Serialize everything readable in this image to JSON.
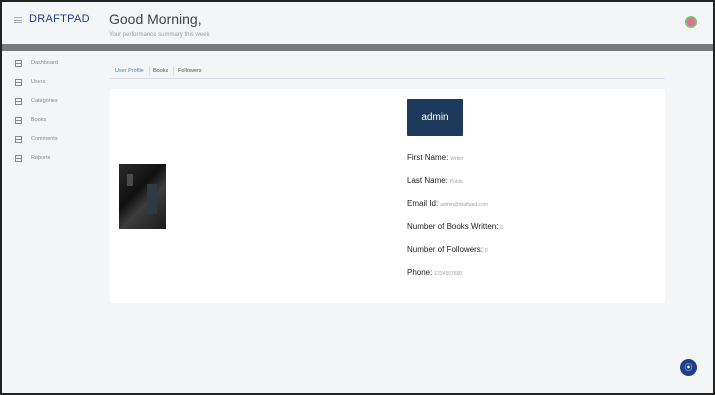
{
  "header": {
    "logo": "DRAFTPAD",
    "greeting": "Good Morning,",
    "subtitle": "Your performance summary this week"
  },
  "sidebar": {
    "items": [
      {
        "label": "Dashboard",
        "icon": "grid-icon"
      },
      {
        "label": "Users",
        "icon": "grid-icon"
      },
      {
        "label": "Categories",
        "icon": "grid-icon"
      },
      {
        "label": "Books",
        "icon": "grid-icon"
      },
      {
        "label": "Comments",
        "icon": "grid-icon"
      },
      {
        "label": "Reports",
        "icon": "grid-icon"
      }
    ]
  },
  "tabs": [
    {
      "label": "User Profile",
      "active": true
    },
    {
      "label": "Books",
      "active": false
    },
    {
      "label": "Followers",
      "active": false
    }
  ],
  "profile": {
    "role_label": "admin",
    "fields": [
      {
        "label": "First Name:",
        "value": "Writer"
      },
      {
        "label": "Last Name:",
        "value": "Public"
      },
      {
        "label": "Email Id:",
        "value": "admin@draftpad.com"
      },
      {
        "label": "Number of Books Written:",
        "value": "0"
      },
      {
        "label": "Number of Followers:",
        "value": "0"
      },
      {
        "label": "Phone:",
        "value": "1234567890"
      }
    ]
  },
  "fab": {
    "icon": "chat-icon",
    "glyph": "⦿"
  },
  "colors": {
    "brand": "#1f3d8a",
    "role_button": "#1d3a5c",
    "band": "#777a7c"
  }
}
